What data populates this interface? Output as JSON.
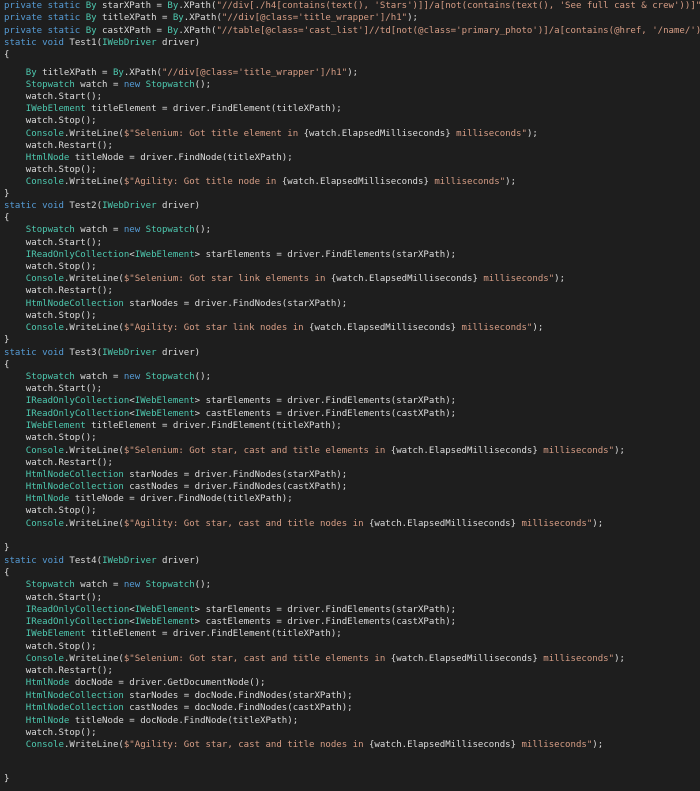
{
  "theme": {
    "background": "#1e1e1e",
    "keyword": "#569cd6",
    "type": "#4ec9b0",
    "string": "#d69d85",
    "text": "#dcdcdc"
  },
  "code_lines": [
    [
      [
        "kw",
        "private static "
      ],
      [
        "type",
        "By "
      ],
      [
        "var",
        "starXPath = "
      ],
      [
        "type",
        "By"
      ],
      [
        "plain",
        ".XPath("
      ],
      [
        "str",
        "\"//div[./h4[contains(text(), 'Stars')]]/a[not(contains(text(), 'See full cast & crew'))]\""
      ],
      [
        "plain",
        ");"
      ]
    ],
    [
      [
        "kw",
        "private static "
      ],
      [
        "type",
        "By "
      ],
      [
        "var",
        "titleXPath = "
      ],
      [
        "type",
        "By"
      ],
      [
        "plain",
        ".XPath("
      ],
      [
        "str",
        "\"//div[@class='title_wrapper']/h1\""
      ],
      [
        "plain",
        ");"
      ]
    ],
    [
      [
        "kw",
        "private static "
      ],
      [
        "type",
        "By "
      ],
      [
        "var",
        "castXPath = "
      ],
      [
        "type",
        "By"
      ],
      [
        "plain",
        ".XPath("
      ],
      [
        "str",
        "\"//table[@class='cast_list']//td[not(@class='primary_photo')]/a[contains(@href, '/name/')]\""
      ],
      [
        "plain",
        ");"
      ]
    ],
    [
      [
        "kw",
        "static void "
      ],
      [
        "plain",
        "Test1("
      ],
      [
        "type",
        "IWebDriver "
      ],
      [
        "plain",
        "driver)"
      ]
    ],
    [
      [
        "plain",
        "{"
      ]
    ],
    [],
    [
      [
        "plain",
        "    "
      ],
      [
        "type",
        "By "
      ],
      [
        "plain",
        "titleXPath = "
      ],
      [
        "type",
        "By"
      ],
      [
        "plain",
        ".XPath("
      ],
      [
        "str",
        "\"//div[@class='title_wrapper']/h1\""
      ],
      [
        "plain",
        ");"
      ]
    ],
    [
      [
        "plain",
        "    "
      ],
      [
        "type",
        "Stopwatch "
      ],
      [
        "plain",
        "watch = "
      ],
      [
        "kw",
        "new "
      ],
      [
        "type",
        "Stopwatch"
      ],
      [
        "plain",
        "();"
      ]
    ],
    [
      [
        "plain",
        "    watch.Start();"
      ]
    ],
    [
      [
        "plain",
        "    "
      ],
      [
        "type",
        "IWebElement "
      ],
      [
        "plain",
        "titleElement = driver.FindElement(titleXPath);"
      ]
    ],
    [
      [
        "plain",
        "    watch.Stop();"
      ]
    ],
    [
      [
        "plain",
        "    "
      ],
      [
        "type",
        "Console"
      ],
      [
        "plain",
        ".WriteLine("
      ],
      [
        "str",
        "$\"Selenium: Got title element in "
      ],
      [
        "interp",
        "{watch.ElapsedMilliseconds}"
      ],
      [
        "str",
        " milliseconds\""
      ],
      [
        "plain",
        ");"
      ]
    ],
    [
      [
        "plain",
        "    watch.Restart();"
      ]
    ],
    [
      [
        "plain",
        "    "
      ],
      [
        "type",
        "HtmlNode "
      ],
      [
        "plain",
        "titleNode = driver.FindNode(titleXPath);"
      ]
    ],
    [
      [
        "plain",
        "    watch.Stop();"
      ]
    ],
    [
      [
        "plain",
        "    "
      ],
      [
        "type",
        "Console"
      ],
      [
        "plain",
        ".WriteLine("
      ],
      [
        "str",
        "$\"Agility: Got title node in "
      ],
      [
        "interp",
        "{watch.ElapsedMilliseconds}"
      ],
      [
        "str",
        " milliseconds\""
      ],
      [
        "plain",
        ");"
      ]
    ],
    [
      [
        "plain",
        "}"
      ]
    ],
    [
      [
        "kw",
        "static void "
      ],
      [
        "plain",
        "Test2("
      ],
      [
        "type",
        "IWebDriver "
      ],
      [
        "plain",
        "driver)"
      ]
    ],
    [
      [
        "plain",
        "{"
      ]
    ],
    [
      [
        "plain",
        "    "
      ],
      [
        "type",
        "Stopwatch "
      ],
      [
        "plain",
        "watch = "
      ],
      [
        "kw",
        "new "
      ],
      [
        "type",
        "Stopwatch"
      ],
      [
        "plain",
        "();"
      ]
    ],
    [
      [
        "plain",
        "    watch.Start();"
      ]
    ],
    [
      [
        "plain",
        "    "
      ],
      [
        "type",
        "IReadOnlyCollection"
      ],
      [
        "plain",
        "<"
      ],
      [
        "type",
        "IWebElement"
      ],
      [
        "plain",
        "> starElements = driver.FindElements(starXPath);"
      ]
    ],
    [
      [
        "plain",
        "    watch.Stop();"
      ]
    ],
    [
      [
        "plain",
        "    "
      ],
      [
        "type",
        "Console"
      ],
      [
        "plain",
        ".WriteLine("
      ],
      [
        "str",
        "$\"Selenium: Got star link elements in "
      ],
      [
        "interp",
        "{watch.ElapsedMilliseconds}"
      ],
      [
        "str",
        " milliseconds\""
      ],
      [
        "plain",
        ");"
      ]
    ],
    [
      [
        "plain",
        "    watch.Restart();"
      ]
    ],
    [
      [
        "plain",
        "    "
      ],
      [
        "type",
        "HtmlNodeCollection "
      ],
      [
        "plain",
        "starNodes = driver.FindNodes(starXPath);"
      ]
    ],
    [
      [
        "plain",
        "    watch.Stop();"
      ]
    ],
    [
      [
        "plain",
        "    "
      ],
      [
        "type",
        "Console"
      ],
      [
        "plain",
        ".WriteLine("
      ],
      [
        "str",
        "$\"Agility: Got star link nodes in "
      ],
      [
        "interp",
        "{watch.ElapsedMilliseconds}"
      ],
      [
        "str",
        " milliseconds\""
      ],
      [
        "plain",
        ");"
      ]
    ],
    [
      [
        "plain",
        "}"
      ]
    ],
    [
      [
        "kw",
        "static void "
      ],
      [
        "plain",
        "Test3("
      ],
      [
        "type",
        "IWebDriver "
      ],
      [
        "plain",
        "driver)"
      ]
    ],
    [
      [
        "plain",
        "{"
      ]
    ],
    [
      [
        "plain",
        "    "
      ],
      [
        "type",
        "Stopwatch "
      ],
      [
        "plain",
        "watch = "
      ],
      [
        "kw",
        "new "
      ],
      [
        "type",
        "Stopwatch"
      ],
      [
        "plain",
        "();"
      ]
    ],
    [
      [
        "plain",
        "    watch.Start();"
      ]
    ],
    [
      [
        "plain",
        "    "
      ],
      [
        "type",
        "IReadOnlyCollection"
      ],
      [
        "plain",
        "<"
      ],
      [
        "type",
        "IWebElement"
      ],
      [
        "plain",
        "> starElements = driver.FindElements(starXPath);"
      ]
    ],
    [
      [
        "plain",
        "    "
      ],
      [
        "type",
        "IReadOnlyCollection"
      ],
      [
        "plain",
        "<"
      ],
      [
        "type",
        "IWebElement"
      ],
      [
        "plain",
        "> castElements = driver.FindElements(castXPath);"
      ]
    ],
    [
      [
        "plain",
        "    "
      ],
      [
        "type",
        "IWebElement "
      ],
      [
        "plain",
        "titleElement = driver.FindElement(titleXPath);"
      ]
    ],
    [
      [
        "plain",
        "    watch.Stop();"
      ]
    ],
    [
      [
        "plain",
        "    "
      ],
      [
        "type",
        "Console"
      ],
      [
        "plain",
        ".WriteLine("
      ],
      [
        "str",
        "$\"Selenium: Got star, cast and title elements in "
      ],
      [
        "interp",
        "{watch.ElapsedMilliseconds}"
      ],
      [
        "str",
        " milliseconds\""
      ],
      [
        "plain",
        ");"
      ]
    ],
    [
      [
        "plain",
        "    watch.Restart();"
      ]
    ],
    [
      [
        "plain",
        "    "
      ],
      [
        "type",
        "HtmlNodeCollection "
      ],
      [
        "plain",
        "starNodes = driver.FindNodes(starXPath);"
      ]
    ],
    [
      [
        "plain",
        "    "
      ],
      [
        "type",
        "HtmlNodeCollection "
      ],
      [
        "plain",
        "castNodes = driver.FindNodes(castXPath);"
      ]
    ],
    [
      [
        "plain",
        "    "
      ],
      [
        "type",
        "HtmlNode "
      ],
      [
        "plain",
        "titleNode = driver.FindNode(titleXPath);"
      ]
    ],
    [
      [
        "plain",
        "    watch.Stop();"
      ]
    ],
    [
      [
        "plain",
        "    "
      ],
      [
        "type",
        "Console"
      ],
      [
        "plain",
        ".WriteLine("
      ],
      [
        "str",
        "$\"Agility: Got star, cast and title nodes in "
      ],
      [
        "interp",
        "{watch.ElapsedMilliseconds}"
      ],
      [
        "str",
        " milliseconds\""
      ],
      [
        "plain",
        ");"
      ]
    ],
    [],
    [
      [
        "plain",
        "}"
      ]
    ],
    [
      [
        "kw",
        "static void "
      ],
      [
        "plain",
        "Test4("
      ],
      [
        "type",
        "IWebDriver "
      ],
      [
        "plain",
        "driver)"
      ]
    ],
    [
      [
        "plain",
        "{"
      ]
    ],
    [
      [
        "plain",
        "    "
      ],
      [
        "type",
        "Stopwatch "
      ],
      [
        "plain",
        "watch = "
      ],
      [
        "kw",
        "new "
      ],
      [
        "type",
        "Stopwatch"
      ],
      [
        "plain",
        "();"
      ]
    ],
    [
      [
        "plain",
        "    watch.Start();"
      ]
    ],
    [
      [
        "plain",
        "    "
      ],
      [
        "type",
        "IReadOnlyCollection"
      ],
      [
        "plain",
        "<"
      ],
      [
        "type",
        "IWebElement"
      ],
      [
        "plain",
        "> starElements = driver.FindElements(starXPath);"
      ]
    ],
    [
      [
        "plain",
        "    "
      ],
      [
        "type",
        "IReadOnlyCollection"
      ],
      [
        "plain",
        "<"
      ],
      [
        "type",
        "IWebElement"
      ],
      [
        "plain",
        "> castElements = driver.FindElements(castXPath);"
      ]
    ],
    [
      [
        "plain",
        "    "
      ],
      [
        "type",
        "IWebElement "
      ],
      [
        "plain",
        "titleElement = driver.FindElement(titleXPath);"
      ]
    ],
    [
      [
        "plain",
        "    watch.Stop();"
      ]
    ],
    [
      [
        "plain",
        "    "
      ],
      [
        "type",
        "Console"
      ],
      [
        "plain",
        ".WriteLine("
      ],
      [
        "str",
        "$\"Selenium: Got star, cast and title elements in "
      ],
      [
        "interp",
        "{watch.ElapsedMilliseconds}"
      ],
      [
        "str",
        " milliseconds\""
      ],
      [
        "plain",
        ");"
      ]
    ],
    [
      [
        "plain",
        "    watch.Restart();"
      ]
    ],
    [
      [
        "plain",
        "    "
      ],
      [
        "type",
        "HtmlNode "
      ],
      [
        "plain",
        "docNode = driver.GetDocumentNode();"
      ]
    ],
    [
      [
        "plain",
        "    "
      ],
      [
        "type",
        "HtmlNodeCollection "
      ],
      [
        "plain",
        "starNodes = docNode.FindNodes(starXPath);"
      ]
    ],
    [
      [
        "plain",
        "    "
      ],
      [
        "type",
        "HtmlNodeCollection "
      ],
      [
        "plain",
        "castNodes = docNode.FindNodes(castXPath);"
      ]
    ],
    [
      [
        "plain",
        "    "
      ],
      [
        "type",
        "HtmlNode "
      ],
      [
        "plain",
        "titleNode = docNode.FindNode(titleXPath);"
      ]
    ],
    [
      [
        "plain",
        "    watch.Stop();"
      ]
    ],
    [
      [
        "plain",
        "    "
      ],
      [
        "type",
        "Console"
      ],
      [
        "plain",
        ".WriteLine("
      ],
      [
        "str",
        "$\"Agility: Got star, cast and title nodes in "
      ],
      [
        "interp",
        "{watch.ElapsedMilliseconds}"
      ],
      [
        "str",
        " milliseconds\""
      ],
      [
        "plain",
        ");"
      ]
    ],
    [],
    [],
    [
      [
        "plain",
        "}"
      ]
    ]
  ]
}
